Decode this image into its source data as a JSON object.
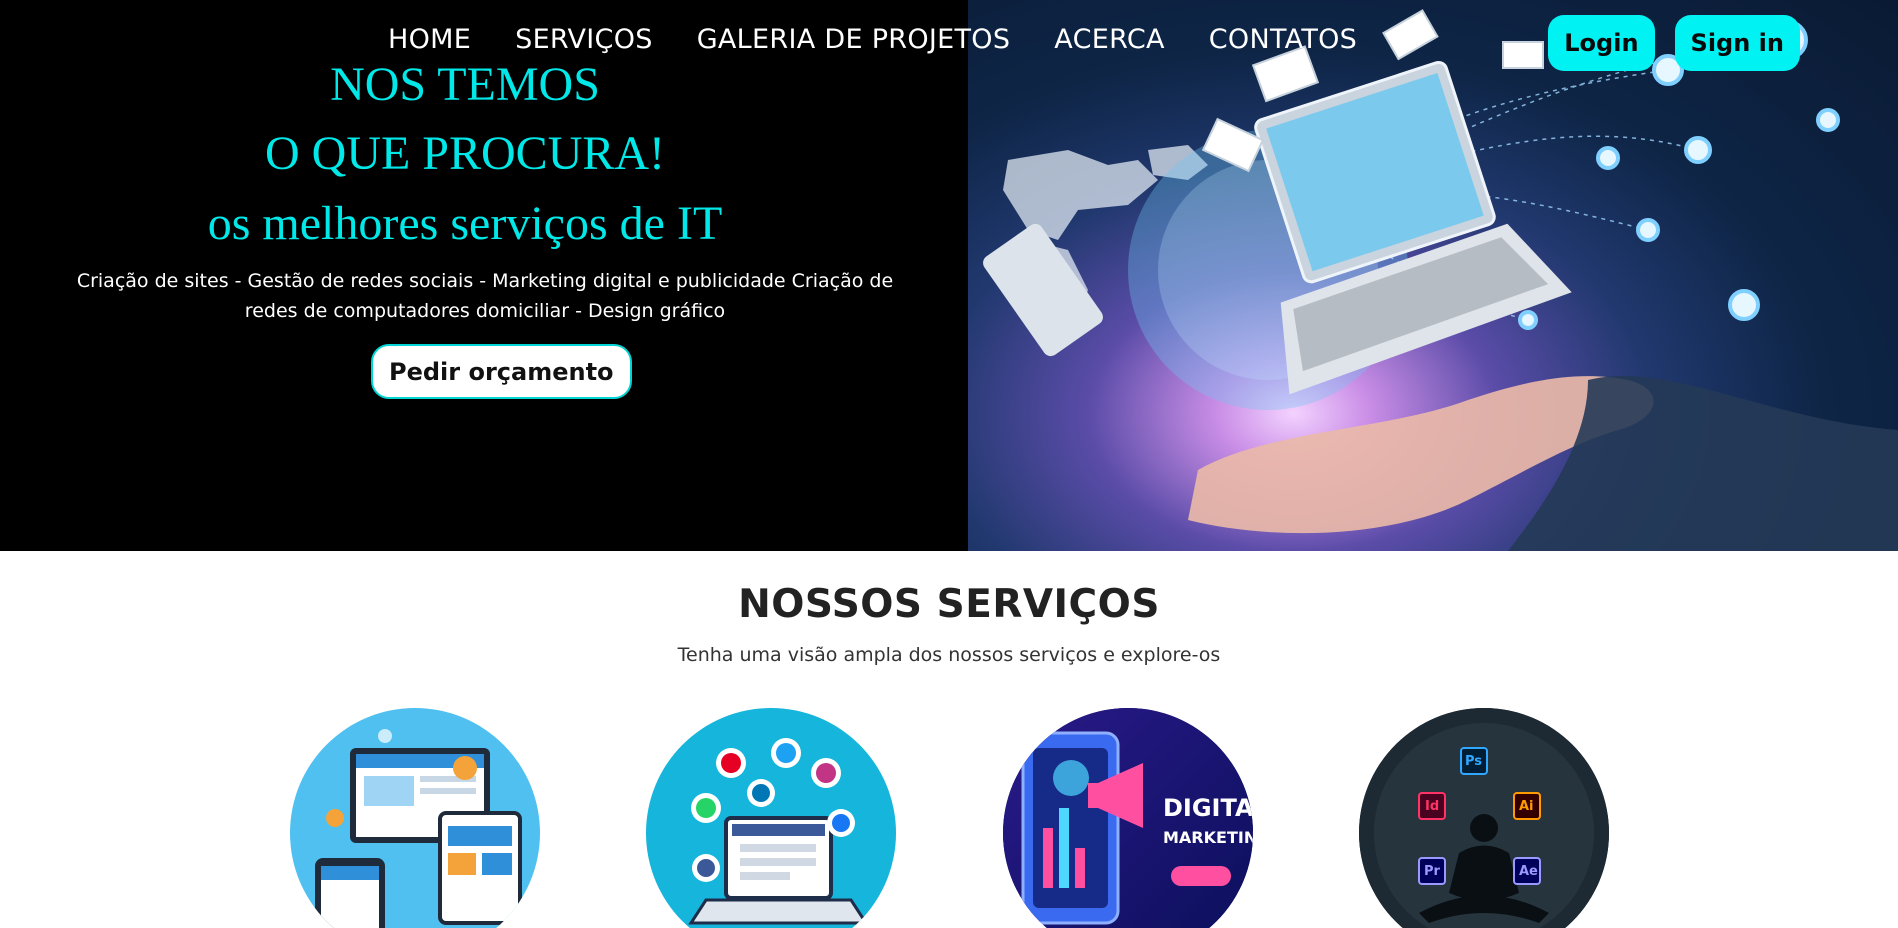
{
  "nav": {
    "items": [
      {
        "label": "HOME"
      },
      {
        "label": "SERVIÇOS"
      },
      {
        "label": "GALERIA DE PROJETOS"
      },
      {
        "label": "ACERCA"
      },
      {
        "label": "CONTATOS"
      }
    ],
    "login_label": "Login",
    "signin_label": "Sign in"
  },
  "hero": {
    "line1": "NOS TEMOS",
    "line2": "O QUE PROCURA!",
    "line3": "os melhores serviços de IT",
    "description": "Criação de sites - Gestão de redes sociais - Marketing digital e publicidade Criação de redes de computadores domiciliar - Design gráfico",
    "cta_label": "Pedir orçamento"
  },
  "services": {
    "title": "NOSSOS SERVIÇOS",
    "subtitle": "Tenha uma visão ampla dos nossos serviços e explore-os",
    "cards": [
      {
        "icon": "web-design-illustration-icon"
      },
      {
        "icon": "social-media-illustration-icon"
      },
      {
        "icon": "digital-marketing-illustration-icon",
        "text_top": "DIGITAL",
        "text_bottom": "MARKETING"
      },
      {
        "icon": "graphic-design-illustration-icon",
        "apps": [
          "Ps",
          "Id",
          "Ai",
          "Pr",
          "Ae"
        ]
      }
    ]
  },
  "colors": {
    "accent": "#00f2f2",
    "hero_text": "#00e8e8",
    "hero_bg": "#000000"
  }
}
